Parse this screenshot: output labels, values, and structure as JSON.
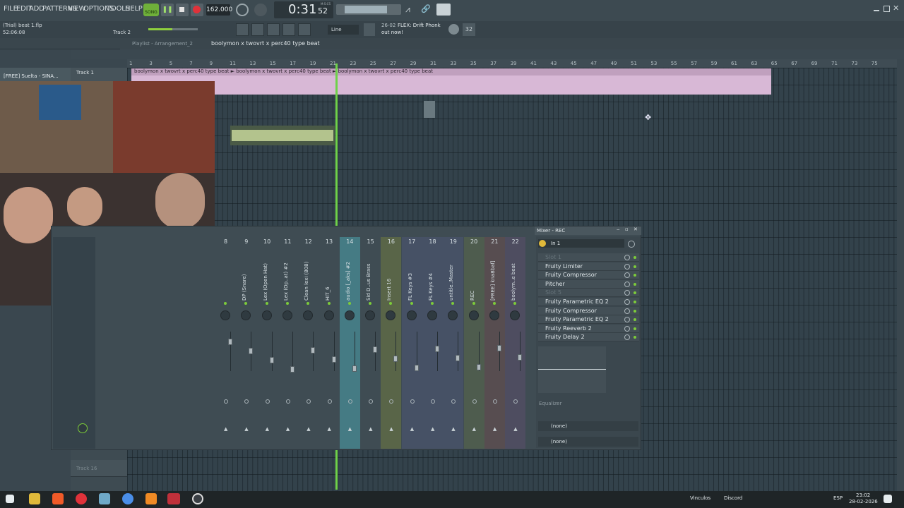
{
  "menu": {
    "items": [
      "FILE",
      "EDIT",
      "ADD",
      "PATTERNS",
      "VIEW",
      "OPTIONS",
      "TOOLS",
      "HELP"
    ]
  },
  "transport": {
    "mode": "SONG",
    "tempo": "162.000",
    "time": "0:31",
    "time_sub": "52",
    "time_unit": "M:S:CS"
  },
  "snap": "Line",
  "news": {
    "date": "26-02",
    "line1": "FLEX: Drift Phonk",
    "line2": "out now!"
  },
  "project": {
    "name": "(Trial) beat 1.flp",
    "position": "52:06:08",
    "hint_track": "Track 2"
  },
  "playlist": {
    "title": "Playlist - Arrangement_2",
    "pattern": "boolymon x twovrt x perc40 type beat",
    "track1": "Track 1",
    "pattern_left": "[FREE] Suelta - SINA...",
    "clip_label": "boolymon x twovrt x perc40 type beat  ►  boolymon x twovrt x perc40 type beat  ►  boolymon x twovrt x perc40 type beat",
    "track16": "Track 16"
  },
  "ruler": [
    "1",
    "3",
    "5",
    "7",
    "9",
    "11",
    "13",
    "15",
    "17",
    "19",
    "21",
    "23",
    "25",
    "27",
    "29",
    "31",
    "33",
    "35",
    "37",
    "39",
    "41",
    "43",
    "45",
    "47",
    "49",
    "51",
    "53",
    "55",
    "57",
    "59",
    "61",
    "63",
    "65",
    "67",
    "69",
    "71",
    "73",
    "75"
  ],
  "mixer": {
    "title": "Mixer - REC",
    "input": "In 1",
    "strips": [
      {
        "num": "8",
        "name": ""
      },
      {
        "num": "9",
        "name": "DP (Snare)"
      },
      {
        "num": "10",
        "name": "Lex (Open Hat)"
      },
      {
        "num": "11",
        "name": "Lex (Op..at) #2"
      },
      {
        "num": "12",
        "name": "Clean lexi (808)"
      },
      {
        "num": "13",
        "name": "HIT_6"
      },
      {
        "num": "14",
        "name": "audio [_aks] #2"
      },
      {
        "num": "15",
        "name": "Sid D..us Brass"
      },
      {
        "num": "16",
        "name": "Insert 16"
      },
      {
        "num": "17",
        "name": "FL Keys #3"
      },
      {
        "num": "18",
        "name": "FL Keys #4"
      },
      {
        "num": "19",
        "name": "untitle..Master"
      },
      {
        "num": "20",
        "name": "REC"
      },
      {
        "num": "21",
        "name": "[FREE] kna8baf]"
      },
      {
        "num": "22",
        "name": "boolym..e beat"
      }
    ],
    "slots": [
      "Slot 1",
      "Fruity Limiter",
      "Fruity Compressor",
      "Pitcher",
      "Slot 5",
      "Fruity Parametric EQ 2",
      "Fruity Compressor",
      "Fruity Parametric EQ 2",
      "Fruity Reeverb 2",
      "Fruity Delay 2"
    ],
    "eq_label": "Equalizer",
    "send1": "(none)",
    "send2": "(none)"
  },
  "taskbar": {
    "vinculos": "Vinculos",
    "discord": "Discord",
    "lang": "ESP",
    "time": "23:02",
    "date": "28-02-2026"
  },
  "colors": {
    "accent_green": "#7dcc3a",
    "record_red": "#e0323a",
    "clip_pink": "#d8b8d6",
    "clip_green": "#c6d69a",
    "playhead": "#6fd14a"
  }
}
